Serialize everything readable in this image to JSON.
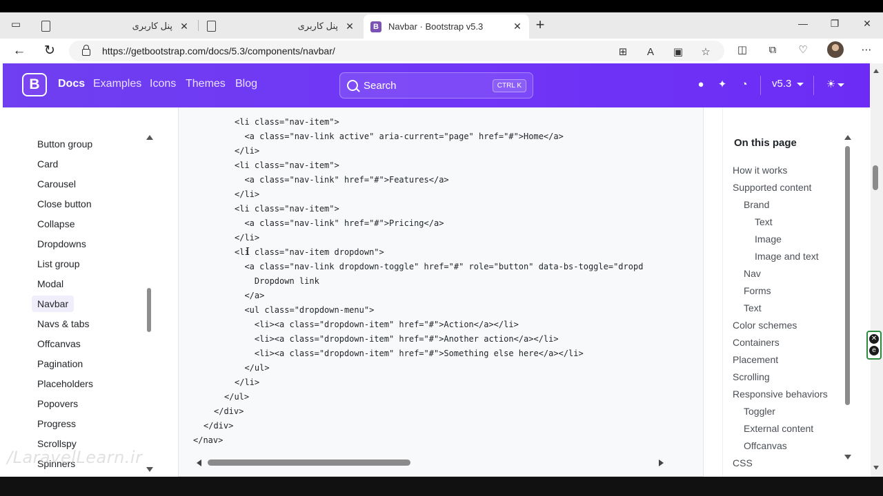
{
  "browser": {
    "tabs": [
      {
        "title": "پنل کاربری",
        "close": "✕"
      },
      {
        "title": "پنل کاربری",
        "close": "✕"
      },
      {
        "title": "Navbar · Bootstrap v5.3",
        "close": "✕",
        "favicon": "B"
      }
    ],
    "new_tab": "+",
    "window_controls": {
      "minimize": "—",
      "maximize": "❐",
      "close": "✕"
    },
    "url": "https://getbootstrap.com/docs/5.3/components/navbar/"
  },
  "bs_navbar": {
    "logo": "B",
    "links": [
      "Docs",
      "Examples",
      "Icons",
      "Themes",
      "Blog"
    ],
    "search": {
      "placeholder": "Search",
      "shortcut": "CTRL K"
    },
    "version": "v5.3",
    "accent": "#7036f6"
  },
  "sidebar": {
    "items": [
      "Button group",
      "Card",
      "Carousel",
      "Close button",
      "Collapse",
      "Dropdowns",
      "List group",
      "Modal",
      "Navbar",
      "Navs & tabs",
      "Offcanvas",
      "Pagination",
      "Placeholders",
      "Popovers",
      "Progress",
      "Scrollspy",
      "Spinners"
    ],
    "active": "Navbar"
  },
  "code": {
    "lines": [
      "<li class=\"nav-item\">",
      "  <a class=\"nav-link active\" aria-current=\"page\" href=\"#\">Home</a>",
      "</li>",
      "<li class=\"nav-item\">",
      "  <a class=\"nav-link\" href=\"#\">Features</a>",
      "</li>",
      "<li class=\"nav-item\">",
      "  <a class=\"nav-link\" href=\"#\">Pricing</a>",
      "</li>",
      "<li class=\"nav-item dropdown\">",
      "  <a class=\"nav-link dropdown-toggle\" href=\"#\" role=\"button\" data-bs-toggle=\"dropd",
      "    Dropdown link",
      "  </a>",
      "  <ul class=\"dropdown-menu\">",
      "    <li><a class=\"dropdown-item\" href=\"#\">Action</a></li>",
      "    <li><a class=\"dropdown-item\" href=\"#\">Another action</a></li>",
      "    <li><a class=\"dropdown-item\" href=\"#\">Something else here</a></li>",
      "  </ul>",
      "</li>",
      "</ul>",
      "</div>",
      "</div>",
      "</nav>"
    ]
  },
  "toc": {
    "title": "On this page",
    "items": [
      "How it works",
      "Supported content",
      "Brand",
      "Text",
      "Image",
      "Image and text",
      "Nav",
      "Forms",
      "Text",
      "Color schemes",
      "Containers",
      "Placement",
      "Scrolling",
      "Responsive behaviors",
      "Toggler",
      "External content",
      "Offcanvas",
      "CSS"
    ]
  },
  "watermark": "/LaravelLearn.ir"
}
